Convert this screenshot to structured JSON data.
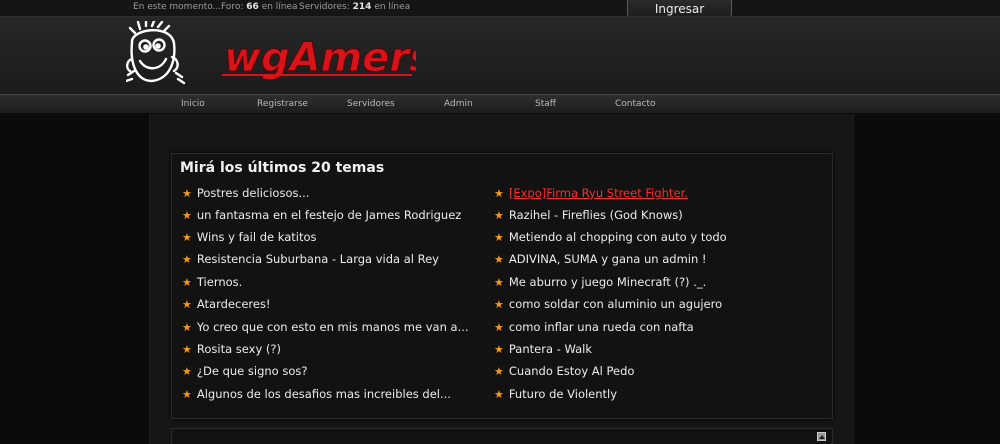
{
  "topbar": {
    "now_label": "En este momento...",
    "foro_label": "Foro:",
    "foro_count": "66",
    "foro_suffix": "en línea",
    "servers_label": "Servidores:",
    "servers_count": "214",
    "servers_suffix": "en línea"
  },
  "login_label": "Ingresar",
  "logo_text": "wgAmers",
  "nav": [
    "Inicio",
    "Registrarse",
    "Servidores",
    "Admin",
    "Staff",
    "Contacto"
  ],
  "panel": {
    "title": "Mirá los últimos 20 temas",
    "left_topics": [
      "Postres deliciosos...",
      "un fantasma en el festejo de James Rodriguez",
      "Wins y fail de katitos",
      "Resistencia Suburbana - Larga vida al Rey",
      "Tiernos.",
      "Atardeceres!",
      "Yo creo que con esto en mis manos me van a...",
      "Rosita sexy (?)",
      "¿De que signo sos?",
      "Algunos de los desafios mas increibles del..."
    ],
    "right_topics": [
      "[Expo]Firma Ryu Street Fighter.",
      "Razihel - Fireflies (God Knows)",
      "Metiendo al chopping con auto y todo",
      "ADIVINA, SUMA y gana un admin !",
      "Me aburro y juego Minecraft (?) ._.",
      "como soldar con aluminio un agujero",
      "como inflar una rueda con nafta",
      "Pantera - Walk",
      "Cuando Estoy Al Pedo",
      "Futuro de Violently"
    ]
  },
  "colors": {
    "star": "#f39a1b",
    "highlight_link": "#ff2a2a",
    "logo_red": "#d8141a"
  }
}
